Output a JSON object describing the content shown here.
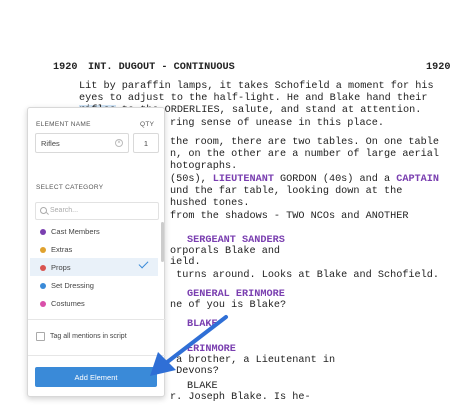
{
  "scene": {
    "number_left": "1920",
    "heading": "INT. DUGOUT - CONTINUOUS",
    "number_right": "1920"
  },
  "script": {
    "l1": "Lit by paraffin lamps, it takes Schofield a moment for his",
    "l2": "eyes to adjust to the half-light. He and Blake hand their",
    "l3_hl": "rifles",
    "l3_rest": " to the ORDERLIES, salute, and stand at attention.",
    "l4": "ring sense of unease in this place.",
    "l5": "the room, there are two tables. On one table",
    "l6": "n, on the other are a number of large aerial",
    "l7": "hotographs.",
    "l8a": "(50s), ",
    "l8b": "LIEUTENANT",
    "l8c": " GORDON (40s) and a ",
    "l8d": "CAPTAIN",
    "l9": "und the far table, looking down at the",
    "l10": "hushed tones.",
    "l11": "from the shadows - TWO NCOs and ANOTHER",
    "l12": "SERGEANT SANDERS",
    "l13": "orporals Blake and",
    "l14": "ield.",
    "l15": " turns around. Looks at Blake and Schofield.",
    "l16": "GENERAL ERINMORE",
    "l17": "ne of you is Blake?",
    "l18": "BLAKE",
    "l19": "ERINMORE",
    "l20": " a brother, a Lieutenant in",
    "l21": " Devons?",
    "l22": "BLAKE",
    "l23": "r. Joseph Blake. Is he-"
  },
  "panel": {
    "element_name_label": "ELEMENT NAME",
    "qty_label": "QTY",
    "element_name_value": "Rifles",
    "qty_value": "1",
    "select_category_label": "SELECT CATEGORY",
    "search_placeholder": "Search...",
    "categories": [
      {
        "label": "Cast Members",
        "color": "#7a3fb0"
      },
      {
        "label": "Extras",
        "color": "#e0a22f"
      },
      {
        "label": "Props",
        "color": "#d9534f"
      },
      {
        "label": "Set Dressing",
        "color": "#3a8ad8"
      },
      {
        "label": "Costumes",
        "color": "#d94fa9"
      }
    ],
    "selected_category": "Props",
    "tag_all_label": "Tag all mentions in script",
    "add_button_label": "Add Element"
  },
  "colors": {
    "accent": "#3a8ad8",
    "character_name": "#7a3fb0"
  }
}
